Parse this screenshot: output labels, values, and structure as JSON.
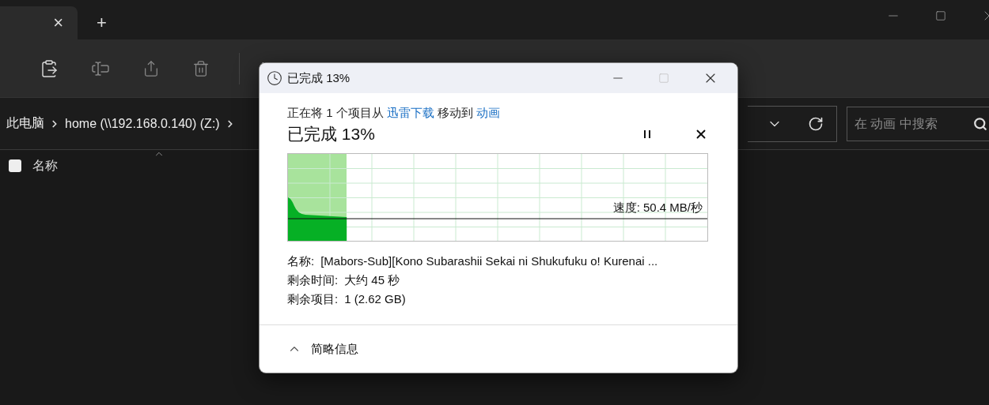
{
  "explorer": {
    "tab_close": "×",
    "new_tab": "+",
    "breadcrumb": [
      "此电脑",
      "home (\\\\192.168.0.140) (Z:)"
    ],
    "search": {
      "placeholder": "在 动画 中搜索"
    },
    "column_header": {
      "label": "名称",
      "checked": false
    }
  },
  "dialog": {
    "title": "已完成 13%",
    "message": {
      "prefix": "正在将 1 个项目从 ",
      "source": "迅雷下载",
      "middle": " 移动到 ",
      "dest": "动画"
    },
    "heading": "已完成 13%",
    "progress": {
      "level": 0.14
    },
    "speed": "速度: 50.4 MB/秒",
    "details": [
      {
        "label": "名称:",
        "value": "[Mabors-Sub][Kono Subarashii Sekai ni Shukufuku o! Kurenai ..."
      },
      {
        "label": "剩余时间:",
        "value": "大约 45 秒"
      },
      {
        "label": "剩余项目:",
        "value": "1 (2.62 GB)"
      }
    ],
    "footer": {
      "label": "简略信息",
      "expanded": true
    }
  }
}
